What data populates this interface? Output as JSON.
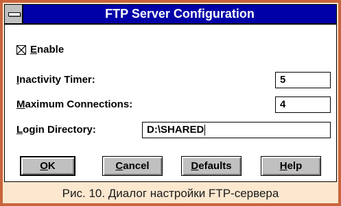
{
  "window": {
    "title": "FTP Server Configuration"
  },
  "enable": {
    "label_key": "E",
    "label_rest": "nable",
    "checked": true
  },
  "inactivity": {
    "label_key": "I",
    "label_rest": "nactivity Timer:",
    "value": "5"
  },
  "max_conn": {
    "label_key": "M",
    "label_rest": "aximum Connections:",
    "value": "4"
  },
  "login_dir": {
    "label_key": "L",
    "label_rest": "ogin Directory:",
    "value": "D:\\SHARED"
  },
  "buttons": {
    "ok_key": "O",
    "ok_rest": "K",
    "cancel_key": "C",
    "cancel_rest": "ancel",
    "defaults_key": "D",
    "defaults_rest": "efaults",
    "help_key": "H",
    "help_rest": "elp"
  },
  "caption": "Рис. 10. Диалог настройки FTP-сервера"
}
